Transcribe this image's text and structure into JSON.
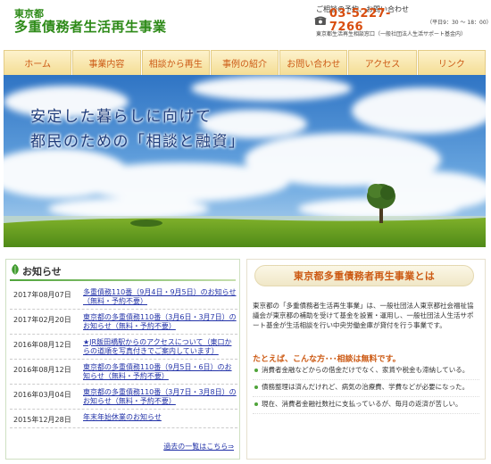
{
  "header": {
    "brand_sub": "東京都",
    "brand_main": "多重債務者生活再生事業",
    "contact_caption": "ご相談の予約、お問い合わせ",
    "phone": "03-5227-7266",
    "hours": "（平日9：30 ～ 18：00）",
    "office": "東京都生活再生相談窓口（一般社団法人生活サポート基金内）",
    "icons": {
      "phone": "phone-icon"
    }
  },
  "nav": {
    "items": [
      "ホーム",
      "事業内容",
      "相談から再生",
      "事例の紹介",
      "お問い合わせ",
      "アクセス",
      "リンク"
    ]
  },
  "hero": {
    "line1": "安定した暮らしに向けて",
    "line2": "都民のための「相談と融資」"
  },
  "news": {
    "title": "お知らせ",
    "icon": "leaf-icon",
    "items": [
      {
        "date": "2017年08月07日",
        "text": "多重債務110番（9月4日・9月5日）のお知らせ（無料・予約不要）"
      },
      {
        "date": "2017年02月20日",
        "text": "東京都の多重債務110番（3月6日・3月7日）のお知らせ（無料・予約不要）"
      },
      {
        "date": "2016年08月12日",
        "text": "★JR飯田橋駅からのアクセスについて（東口からの道順を写真付きでご案内しています）"
      },
      {
        "date": "2016年08月12日",
        "text": "東京都の多重債務110番（9月5日・6日）のお知らせ（無料・予約不要）"
      },
      {
        "date": "2016年03月04日",
        "text": "東京都の多重債務110番（3月7日・3月8日）のお知らせ（無料・予約不要）"
      },
      {
        "date": "2015年12月28日",
        "text": "年末年始休業のお知らせ"
      }
    ],
    "more": "過去の一覧はこちら⇒"
  },
  "about": {
    "title": "東京都多重債務者再生事業とは",
    "body": "東京都の「多重債務者生活再生事業」は、一般社団法人東京都社会福祉協議会が東京都の補助を受けて基金を設置・運用し、一般社団法人生活サポート基金が生活相談を行い中央労働金庫が貸付を行う事業です。",
    "example_heading": "たとえば、こんな方･･･相談は無料です。",
    "examples": [
      "消費者金融などからの借金だけでなく、家賃や税金も滞納している。",
      "債務整理は済んだけれど、病気の治療費、学費などが必要になった。",
      "現在、消費者金融社数社に支払っているが、毎月の返済が苦しい。"
    ]
  },
  "colors": {
    "brand_green": "#2d8a18",
    "accent_orange": "#cc5a14",
    "phone_orange": "#d84d0f",
    "link_blue": "#2333a8",
    "nav_bg": "#f4dd95"
  }
}
